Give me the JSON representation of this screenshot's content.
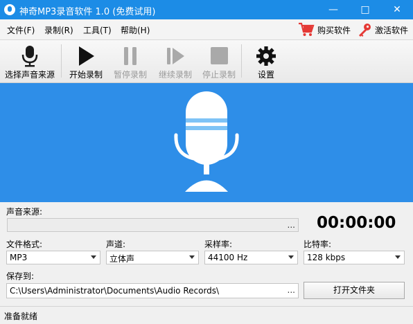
{
  "window": {
    "title": "神奇MP3录音软件 1.0 (免费试用)",
    "minimize": "—",
    "maximize": "□",
    "close": "✕"
  },
  "menu": {
    "items": [
      "文件(F)",
      "录制(R)",
      "工具(T)",
      "帮助(H)"
    ],
    "buy": "购买软件",
    "activate": "激活软件"
  },
  "toolbar": {
    "items": [
      {
        "label": "选择声音来源",
        "icon": "microphone-icon",
        "enabled": true
      },
      {
        "label": "开始录制",
        "icon": "play-icon",
        "enabled": true
      },
      {
        "label": "暂停录制",
        "icon": "pause-icon",
        "enabled": false
      },
      {
        "label": "继续录制",
        "icon": "resume-icon",
        "enabled": false
      },
      {
        "label": "停止录制",
        "icon": "stop-icon",
        "enabled": false
      },
      {
        "label": "设置",
        "icon": "gear-icon",
        "enabled": true
      }
    ]
  },
  "form": {
    "source_label": "声音来源:",
    "source_value": "",
    "browse": "...",
    "timer": "00:00:00",
    "format_label": "文件格式:",
    "format_value": "MP3",
    "channel_label": "声道:",
    "channel_value": "立体声",
    "samplerate_label": "采样率:",
    "samplerate_value": "44100 Hz",
    "bitrate_label": "比特率:",
    "bitrate_value": "128 kbps",
    "saveto_label": "保存到:",
    "saveto_value": "C:\\Users\\Administrator\\Documents\\Audio Records\\",
    "open_folder": "打开文件夹"
  },
  "status": {
    "text": "准备就绪"
  },
  "colors": {
    "titlebar": "#1c8ce6",
    "hero": "#2e8ee8"
  }
}
